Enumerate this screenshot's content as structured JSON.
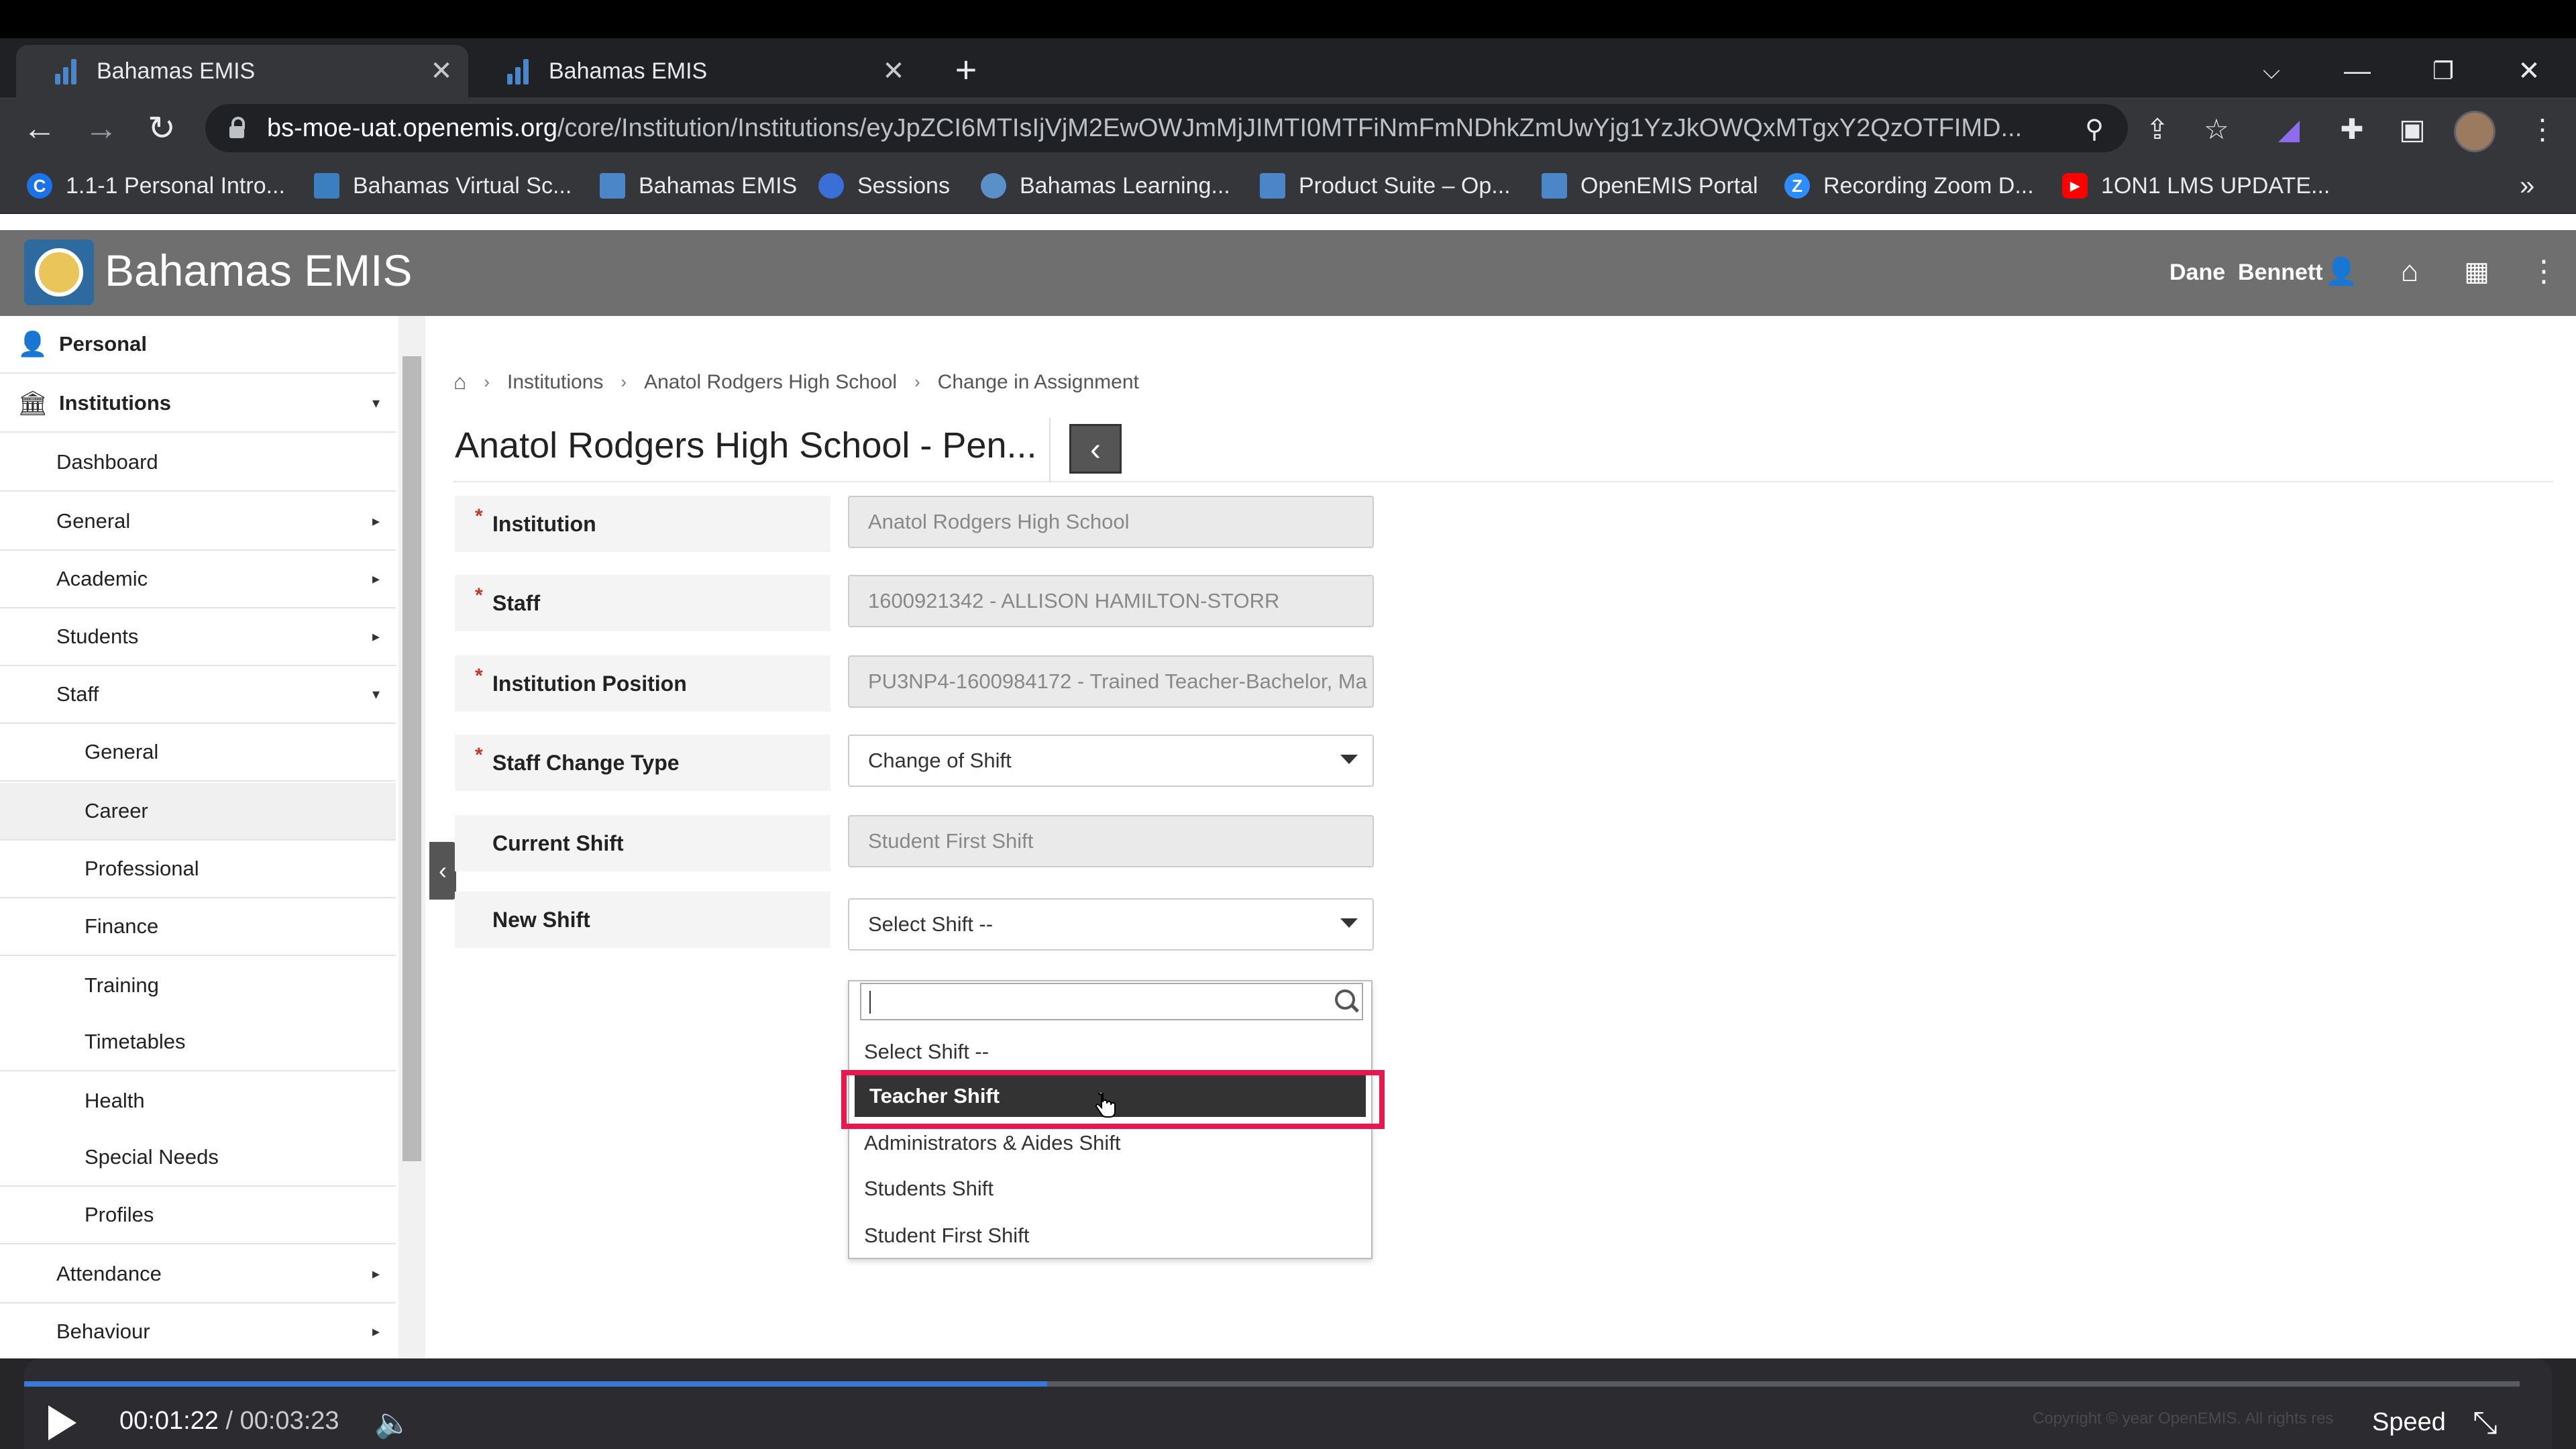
{
  "browser": {
    "tabs": [
      {
        "title": "Bahamas EMIS"
      },
      {
        "title": "Bahamas EMIS"
      }
    ],
    "new_tab": "+",
    "url_host": "bs-moe-uat.openemis.org",
    "url_path": "/core/Institution/Institutions/eyJpZCI6MTIsIjVjM2EwOWJmMjJIMTI0MTFiNmFmNDhkZmUwYjg1YzJkOWQxMTgxY2QzOTFIMD...",
    "bookmarks": [
      {
        "label": "1.1-1 Personal Intro...",
        "icon": "C",
        "color": "#1a73e8"
      },
      {
        "label": "Bahamas Virtual Sc...",
        "icon": "",
        "color": "#3c7fc0"
      },
      {
        "label": "Bahamas EMIS",
        "icon": "",
        "color": "#4a86c8"
      },
      {
        "label": "Sessions",
        "icon": "",
        "color": "#3a6fd8"
      },
      {
        "label": "Bahamas Learning...",
        "icon": "",
        "color": "#5a90c8"
      },
      {
        "label": "Product Suite – Op...",
        "icon": "",
        "color": "#4a86c8"
      },
      {
        "label": "OpenEMIS Portal",
        "icon": "",
        "color": "#4a86c8"
      },
      {
        "label": "Recording Zoom D...",
        "icon": "Z",
        "color": "#2d8cff"
      },
      {
        "label": "1ON1 LMS UPDATE...",
        "icon": "▶",
        "color": "#ff0000"
      }
    ],
    "more_bookmarks": "»"
  },
  "app": {
    "title": "Bahamas EMIS",
    "user_first": "Dane",
    "user_last": "Bennett"
  },
  "sidebar": {
    "items": [
      {
        "label": "Personal",
        "level": 0,
        "icon": "user-icon",
        "caret": ""
      },
      {
        "label": "Institutions",
        "level": 0,
        "icon": "bank-icon",
        "caret": "▾"
      },
      {
        "label": "Dashboard",
        "level": 1,
        "caret": ""
      },
      {
        "label": "General",
        "level": 1,
        "caret": "▸"
      },
      {
        "label": "Academic",
        "level": 1,
        "caret": "▸"
      },
      {
        "label": "Students",
        "level": 1,
        "caret": "▸"
      },
      {
        "label": "Staff",
        "level": 1,
        "caret": "▾"
      },
      {
        "label": "General",
        "level": 2,
        "caret": ""
      },
      {
        "label": "Career",
        "level": 2,
        "caret": "",
        "active": true
      },
      {
        "label": "Professional",
        "level": 2,
        "caret": ""
      },
      {
        "label": "Finance",
        "level": 2,
        "caret": ""
      },
      {
        "label": "Training",
        "level": 2,
        "caret": ""
      },
      {
        "label": "Timetables",
        "level": 2,
        "caret": ""
      },
      {
        "label": "Health",
        "level": 2,
        "caret": ""
      },
      {
        "label": "Special Needs",
        "level": 2,
        "caret": ""
      },
      {
        "label": "Profiles",
        "level": 2,
        "caret": ""
      },
      {
        "label": "Attendance",
        "level": 1,
        "caret": "▸"
      },
      {
        "label": "Behaviour",
        "level": 1,
        "caret": "▸"
      }
    ]
  },
  "breadcrumb": [
    "Institutions",
    "Anatol Rodgers High School",
    "Change in Assignment"
  ],
  "page_title": "Anatol Rodgers High School - Pen...",
  "form": {
    "fields": [
      {
        "label": "Institution",
        "required": true,
        "value": "Anatol Rodgers High School",
        "type": "readonly"
      },
      {
        "label": "Staff",
        "required": true,
        "value": "1600921342 - ALLISON HAMILTON-STORR",
        "type": "readonly"
      },
      {
        "label": "Institution Position",
        "required": true,
        "value": "PU3NP4-1600984172 - Trained Teacher-Bachelor, Ma",
        "type": "readonly"
      },
      {
        "label": "Staff Change Type",
        "required": true,
        "value": "Change of Shift",
        "type": "select"
      },
      {
        "label": "Current Shift",
        "required": false,
        "value": "Student First Shift",
        "type": "readonly"
      },
      {
        "label": "New Shift",
        "required": false,
        "value": "Select Shift --",
        "type": "select"
      }
    ],
    "new_shift_options": [
      "Select Shift --",
      "Teacher Shift",
      "Administrators & Aides Shift",
      "Students Shift",
      "Student First Shift"
    ],
    "highlighted_option": "Teacher Shift"
  },
  "player": {
    "current": "00:01:22",
    "separator": "/",
    "duration": "00:03:23",
    "progress": 0.41,
    "speed_label": "Speed",
    "copyright": "Copyright © year OpenEMIS. All rights res"
  }
}
